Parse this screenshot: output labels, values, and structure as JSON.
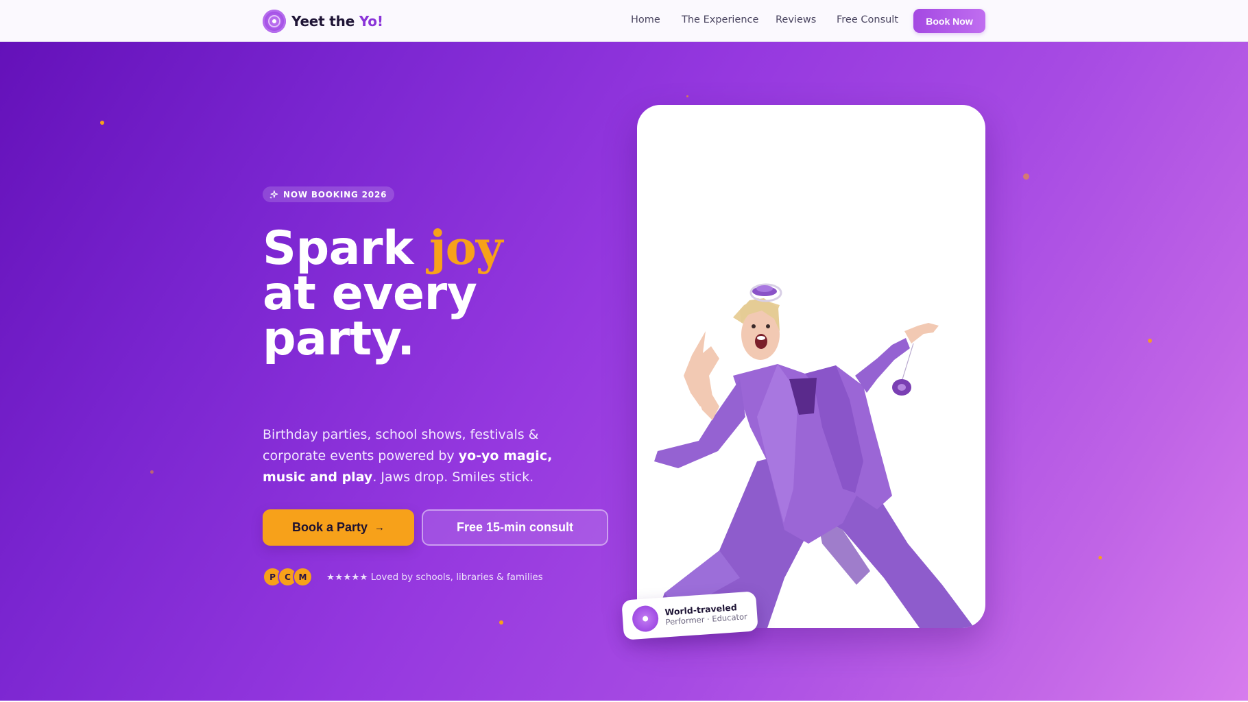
{
  "colors": {
    "accent": "#f7a11a",
    "brand_purple": "#8a34d8",
    "hero_start": "#6411b9",
    "hero_end": "#d77ced"
  },
  "nav": {
    "brand_prefix": "Yeet the ",
    "brand_accent": "Yo!",
    "logo_icon": "yoyo-disc-icon",
    "links": [
      "Home",
      "The Experience",
      "Reviews",
      "Free Consult"
    ],
    "cta": "Book Now"
  },
  "hero": {
    "badge_icon": "sparkles-icon",
    "badge": "NOW BOOKING 2026",
    "headline": {
      "word1": "Spark ",
      "highlight": "joy",
      "line2": "at every",
      "line3": "party."
    },
    "subtext": {
      "part1": "Birthday parties, school shows, festivals & corporate events powered by ",
      "bold": "yo-yo magic, music and play",
      "part2": ". Jaws drop. Smiles stick."
    },
    "primary_button": "Book a Party",
    "primary_button_arrow": "→",
    "secondary_button": "Free 15-min consult",
    "avatars": [
      "P",
      "C",
      "M"
    ],
    "social_proof": "★★★★★ Loved by schools, libraries & families",
    "card": {
      "title": "World-traveled",
      "subtitle": "Performer · Educator",
      "icon": "yoyo-disc-icon"
    }
  }
}
